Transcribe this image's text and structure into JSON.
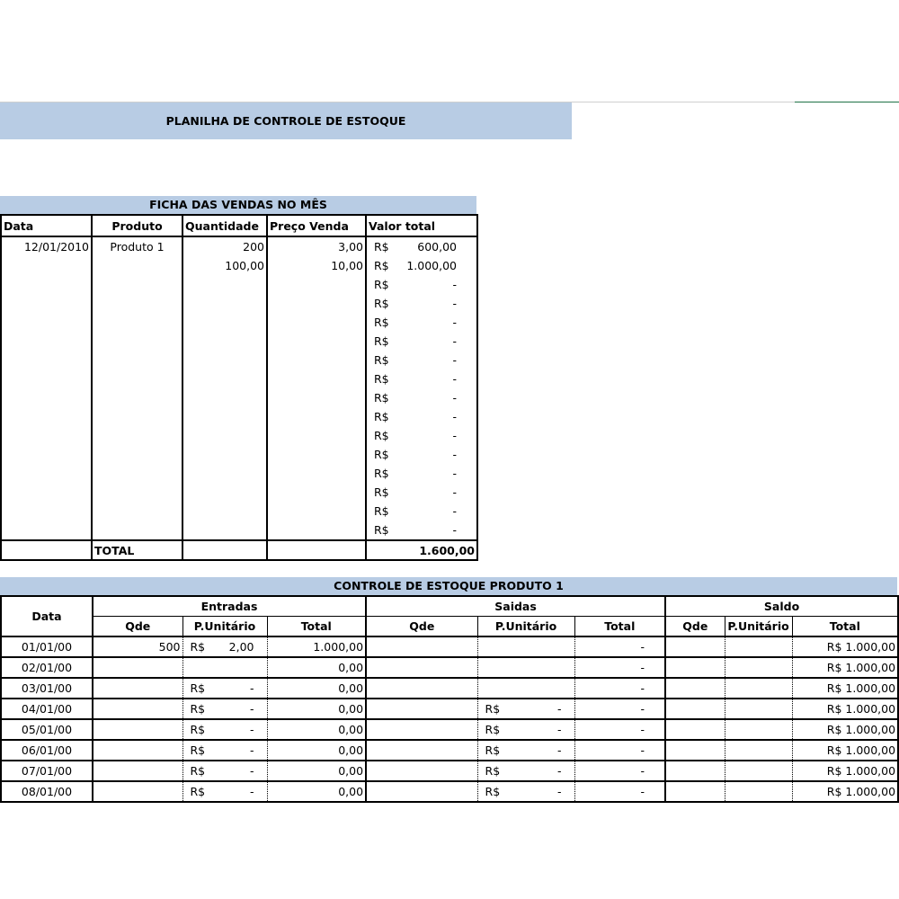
{
  "sheet": {
    "title": "PLANILHA DE CONTROLE DE ESTOQUE"
  },
  "vendas": {
    "heading": "FICHA DAS VENDAS NO MÊS",
    "columns": [
      "Data",
      "Produto",
      "Quantidade",
      "Preço Venda",
      "Valor total"
    ],
    "rows": [
      {
        "data": "12/01/2010",
        "produto": "Produto 1",
        "quantidade": "200",
        "preco": "3,00",
        "moeda": "R$",
        "valor": "600,00"
      },
      {
        "data": "",
        "produto": "",
        "quantidade": "100,00",
        "preco": "10,00",
        "moeda": "R$",
        "valor": "1.000,00"
      },
      {
        "data": "",
        "produto": "",
        "quantidade": "",
        "preco": "",
        "moeda": "R$",
        "valor": "-"
      },
      {
        "data": "",
        "produto": "",
        "quantidade": "",
        "preco": "",
        "moeda": "R$",
        "valor": "-"
      },
      {
        "data": "",
        "produto": "",
        "quantidade": "",
        "preco": "",
        "moeda": "R$",
        "valor": "-"
      },
      {
        "data": "",
        "produto": "",
        "quantidade": "",
        "preco": "",
        "moeda": "R$",
        "valor": "-"
      },
      {
        "data": "",
        "produto": "",
        "quantidade": "",
        "preco": "",
        "moeda": "R$",
        "valor": "-"
      },
      {
        "data": "",
        "produto": "",
        "quantidade": "",
        "preco": "",
        "moeda": "R$",
        "valor": "-"
      },
      {
        "data": "",
        "produto": "",
        "quantidade": "",
        "preco": "",
        "moeda": "R$",
        "valor": "-"
      },
      {
        "data": "",
        "produto": "",
        "quantidade": "",
        "preco": "",
        "moeda": "R$",
        "valor": "-"
      },
      {
        "data": "",
        "produto": "",
        "quantidade": "",
        "preco": "",
        "moeda": "R$",
        "valor": "-"
      },
      {
        "data": "",
        "produto": "",
        "quantidade": "",
        "preco": "",
        "moeda": "R$",
        "valor": "-"
      },
      {
        "data": "",
        "produto": "",
        "quantidade": "",
        "preco": "",
        "moeda": "R$",
        "valor": "-"
      },
      {
        "data": "",
        "produto": "",
        "quantidade": "",
        "preco": "",
        "moeda": "R$",
        "valor": "-"
      },
      {
        "data": "",
        "produto": "",
        "quantidade": "",
        "preco": "",
        "moeda": "R$",
        "valor": "-"
      },
      {
        "data": "",
        "produto": "",
        "quantidade": "",
        "preco": "",
        "moeda": "R$",
        "valor": "-"
      }
    ],
    "total_label": "TOTAL",
    "total_value": "1.600,00"
  },
  "estoque": {
    "heading": "CONTROLE DE ESTOQUE PRODUTO 1",
    "col_data": "Data",
    "groups": [
      "Entradas",
      "Saidas",
      "Saldo"
    ],
    "sub": [
      "Qde",
      "P.Unitário",
      "Total"
    ],
    "rows": [
      {
        "data": "01/01/00",
        "e_qde": "500",
        "e_cur": "R$",
        "e_pu": "2,00",
        "e_total": "1.000,00",
        "s_qde": "",
        "s_cur": "",
        "s_pu": "",
        "s_total": "-",
        "sd_qde": "",
        "sd_pu": "",
        "sd_total": "R$ 1.000,00"
      },
      {
        "data": "02/01/00",
        "e_qde": "",
        "e_cur": "",
        "e_pu": "",
        "e_total": "0,00",
        "s_qde": "",
        "s_cur": "",
        "s_pu": "",
        "s_total": "-",
        "sd_qde": "",
        "sd_pu": "",
        "sd_total": "R$ 1.000,00"
      },
      {
        "data": "03/01/00",
        "e_qde": "",
        "e_cur": "R$",
        "e_pu": "-",
        "e_total": "0,00",
        "s_qde": "",
        "s_cur": "",
        "s_pu": "",
        "s_total": "-",
        "sd_qde": "",
        "sd_pu": "",
        "sd_total": "R$ 1.000,00"
      },
      {
        "data": "04/01/00",
        "e_qde": "",
        "e_cur": "R$",
        "e_pu": "-",
        "e_total": "0,00",
        "s_qde": "",
        "s_cur": "R$",
        "s_pu": "-",
        "s_total": "-",
        "sd_qde": "",
        "sd_pu": "",
        "sd_total": "R$ 1.000,00"
      },
      {
        "data": "05/01/00",
        "e_qde": "",
        "e_cur": "R$",
        "e_pu": "-",
        "e_total": "0,00",
        "s_qde": "",
        "s_cur": "R$",
        "s_pu": "-",
        "s_total": "-",
        "sd_qde": "",
        "sd_pu": "",
        "sd_total": "R$ 1.000,00"
      },
      {
        "data": "06/01/00",
        "e_qde": "",
        "e_cur": "R$",
        "e_pu": "-",
        "e_total": "0,00",
        "s_qde": "",
        "s_cur": "R$",
        "s_pu": "-",
        "s_total": "-",
        "sd_qde": "",
        "sd_pu": "",
        "sd_total": "R$ 1.000,00"
      },
      {
        "data": "07/01/00",
        "e_qde": "",
        "e_cur": "R$",
        "e_pu": "-",
        "e_total": "0,00",
        "s_qde": "",
        "s_cur": "R$",
        "s_pu": "-",
        "s_total": "-",
        "sd_qde": "",
        "sd_pu": "",
        "sd_total": "R$ 1.000,00"
      },
      {
        "data": "08/01/00",
        "e_qde": "",
        "e_cur": "R$",
        "e_pu": "-",
        "e_total": "0,00",
        "s_qde": "",
        "s_cur": "R$",
        "s_pu": "-",
        "s_total": "-",
        "sd_qde": "",
        "sd_pu": "",
        "sd_total": "R$ 1.000,00"
      }
    ]
  }
}
